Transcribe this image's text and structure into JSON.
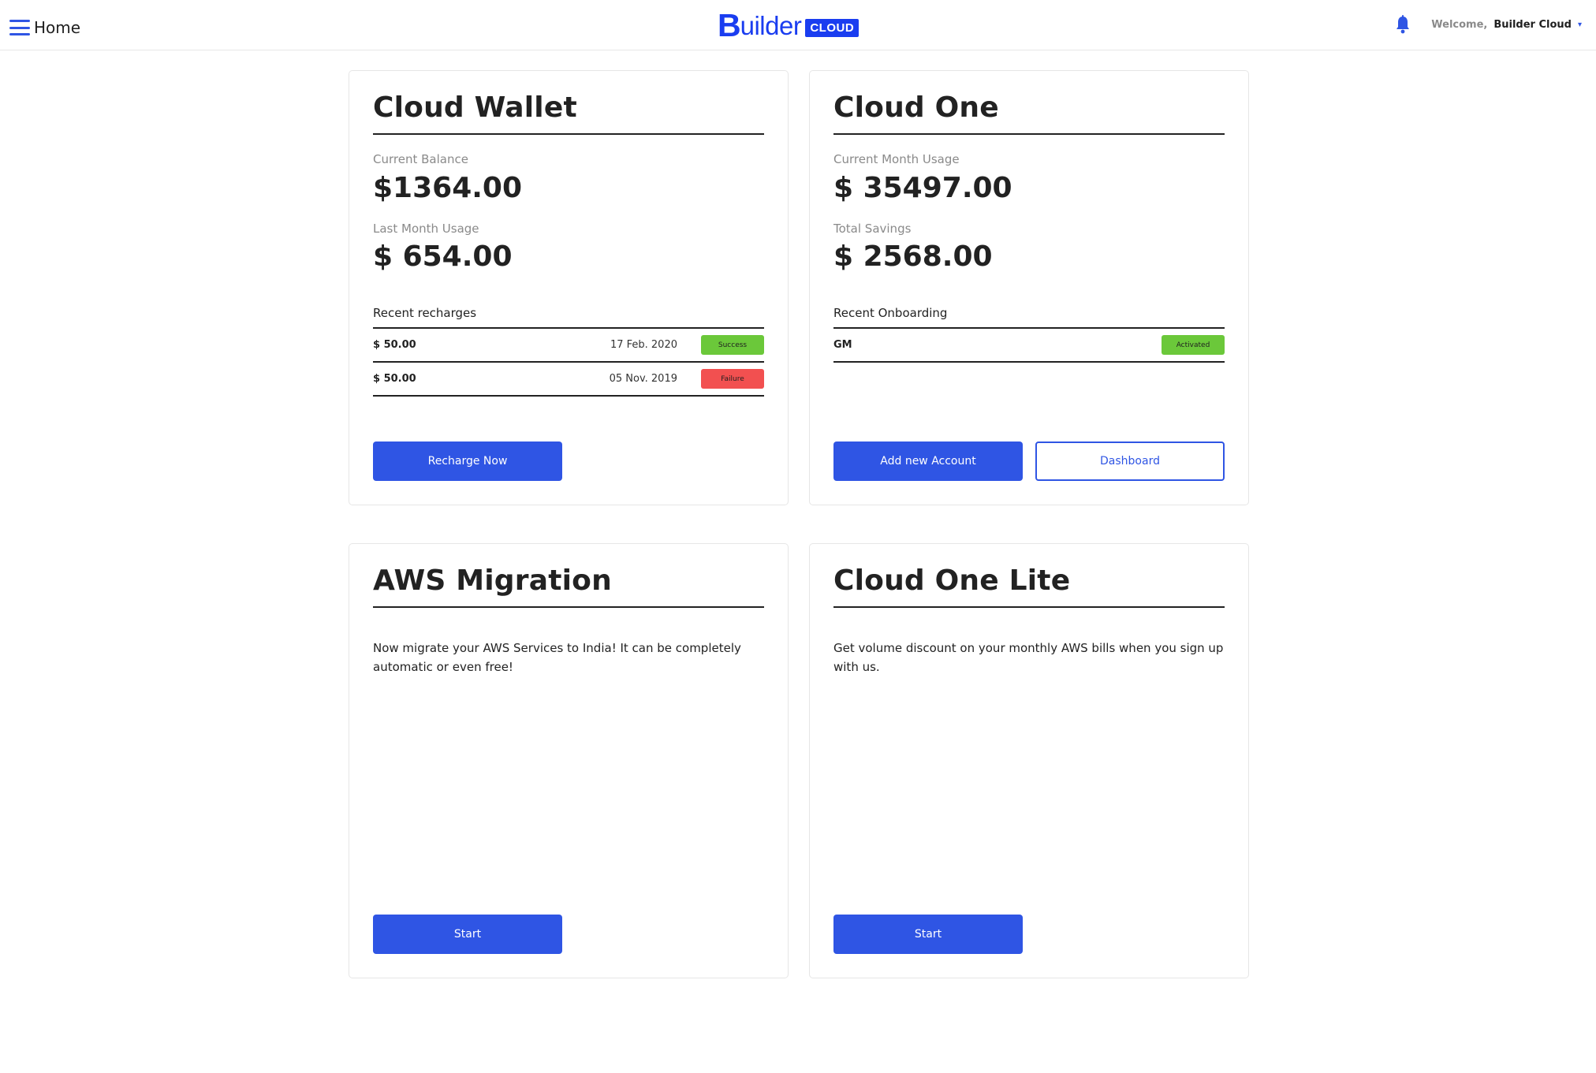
{
  "header": {
    "home_label": "Home",
    "logo_word": "uilder",
    "logo_initial": "B",
    "logo_badge": "CLOUD",
    "welcome": "Welcome,",
    "username": "Builder Cloud",
    "caret": "▾",
    "accent_color": "#2f55e4"
  },
  "wallet": {
    "title": "Cloud Wallet",
    "balance_label": "Current Balance",
    "balance_value": "$1364.00",
    "last_month_label": "Last Month Usage",
    "last_month_value": "$ 654.00",
    "recent_label": "Recent recharges",
    "recharges": [
      {
        "amount": "$ 50.00",
        "date": "17 Feb. 2020",
        "status": "Success"
      },
      {
        "amount": "$ 50.00",
        "date": "05 Nov. 2019",
        "status": "Failure"
      }
    ],
    "recharge_button": "Recharge Now"
  },
  "cloud_one": {
    "title": "Cloud One",
    "usage_label": "Current Month Usage",
    "usage_value": "$ 35497.00",
    "savings_label": "Total Savings",
    "savings_value": "$ 2568.00",
    "recent_label": "Recent Onboarding",
    "onboarding": [
      {
        "name": "GM",
        "status": "Activated"
      }
    ],
    "add_button": "Add new Account",
    "dashboard_button": "Dashboard"
  },
  "aws_migration": {
    "title": "AWS Migration",
    "description": "Now migrate your AWS Services to India! It can be completely automatic or even free!",
    "start_button": "Start"
  },
  "cloud_one_lite": {
    "title": "Cloud One Lite",
    "description": "Get volume discount on your monthly AWS bills when you sign up with us.",
    "start_button": "Start"
  },
  "colors": {
    "success": "#6bc83a",
    "failure": "#f25050",
    "brand": "#1a3df0"
  }
}
